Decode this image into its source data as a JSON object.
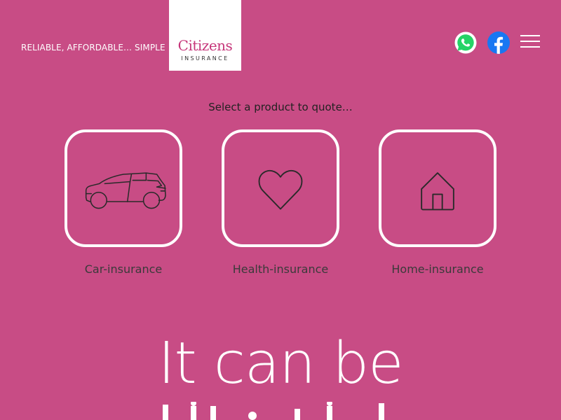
{
  "header": {
    "tagline": "RELIABLE, AFFORDABLE… SIMPLE",
    "logo": {
      "name": "Citizens",
      "sub": "INSURANCE"
    },
    "icons": [
      "whatsapp-icon",
      "facebook-icon",
      "menu-icon"
    ]
  },
  "main": {
    "prompt": "Select a product to quote…",
    "products": [
      {
        "label": "Car-insurance",
        "icon": "car-icon"
      },
      {
        "label": "Health-insurance",
        "icon": "heart-icon"
      },
      {
        "label": "Home-insurance",
        "icon": "house-icon"
      }
    ],
    "hero": "It can be"
  },
  "colors": {
    "background": "#c84c85",
    "brand": "#c6367a",
    "whatsapp": "#25d366",
    "facebook": "#1877f2"
  }
}
